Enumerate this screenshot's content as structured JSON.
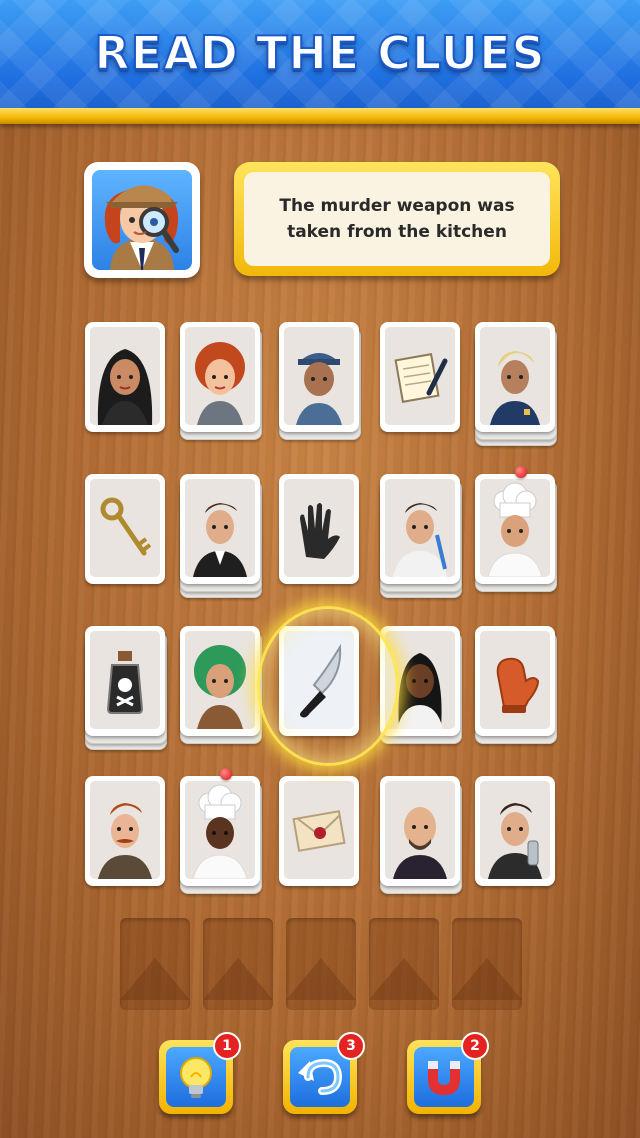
{
  "header": {
    "title": "READ THE CLUES"
  },
  "clue": {
    "text": "The murder weapon was taken from the kitchen",
    "avatar_icon": "detective-avatar-icon"
  },
  "board": {
    "rows": [
      [
        {
          "name": "card-woman-black-hair",
          "icon": "woman-black-hair-icon",
          "stack": 1
        },
        {
          "name": "card-artist-red-hair",
          "icon": "artist-red-hair-icon",
          "stack": 2
        },
        {
          "name": "card-mailman",
          "icon": "mailman-icon",
          "stack": 2
        },
        {
          "name": "card-notepad",
          "icon": "notepad-pen-icon",
          "stack": 1
        },
        {
          "name": "card-police-officer",
          "icon": "police-officer-icon",
          "stack": 3
        }
      ],
      [
        {
          "name": "card-key",
          "icon": "key-icon",
          "stack": 1
        },
        {
          "name": "card-man-suit",
          "icon": "man-suit-icon",
          "stack": 3
        },
        {
          "name": "card-gloves",
          "icon": "gloves-icon",
          "stack": 1
        },
        {
          "name": "card-dentist",
          "icon": "dentist-icon",
          "stack": 3
        },
        {
          "name": "card-chef",
          "icon": "chef-icon",
          "stack": 2,
          "pin": true
        }
      ],
      [
        {
          "name": "card-poison",
          "icon": "poison-bottle-icon",
          "stack": 3
        },
        {
          "name": "card-woman-green-hair",
          "icon": "woman-green-hair-icon",
          "stack": 2
        },
        {
          "name": "card-knife",
          "icon": "knife-icon",
          "stack": 1,
          "highlight": true
        },
        {
          "name": "card-doctor",
          "icon": "doctor-icon",
          "stack": 2
        },
        {
          "name": "card-oven-mitt",
          "icon": "oven-mitt-icon",
          "stack": 2
        }
      ],
      [
        {
          "name": "card-man-mustache",
          "icon": "man-mustache-icon",
          "stack": 1
        },
        {
          "name": "card-chef-2",
          "icon": "chef-2-icon",
          "stack": 2,
          "pin": true
        },
        {
          "name": "card-letter",
          "icon": "sealed-letter-icon",
          "stack": 1
        },
        {
          "name": "card-bald-man",
          "icon": "bald-man-icon",
          "stack": 2
        },
        {
          "name": "card-bartender",
          "icon": "bartender-icon",
          "stack": 1
        }
      ]
    ]
  },
  "slots": {
    "count": 5
  },
  "powerups": [
    {
      "name": "hint-button",
      "icon": "lightbulb-icon",
      "count": "1"
    },
    {
      "name": "undo-button",
      "icon": "undo-arrow-icon",
      "count": "3"
    },
    {
      "name": "magnet-button",
      "icon": "magnet-icon",
      "count": "2"
    }
  ],
  "colors": {
    "header_blue": "#2a7fe8",
    "gold": "#f2b705",
    "wood": "#b06b33",
    "badge_red": "#e52222"
  }
}
